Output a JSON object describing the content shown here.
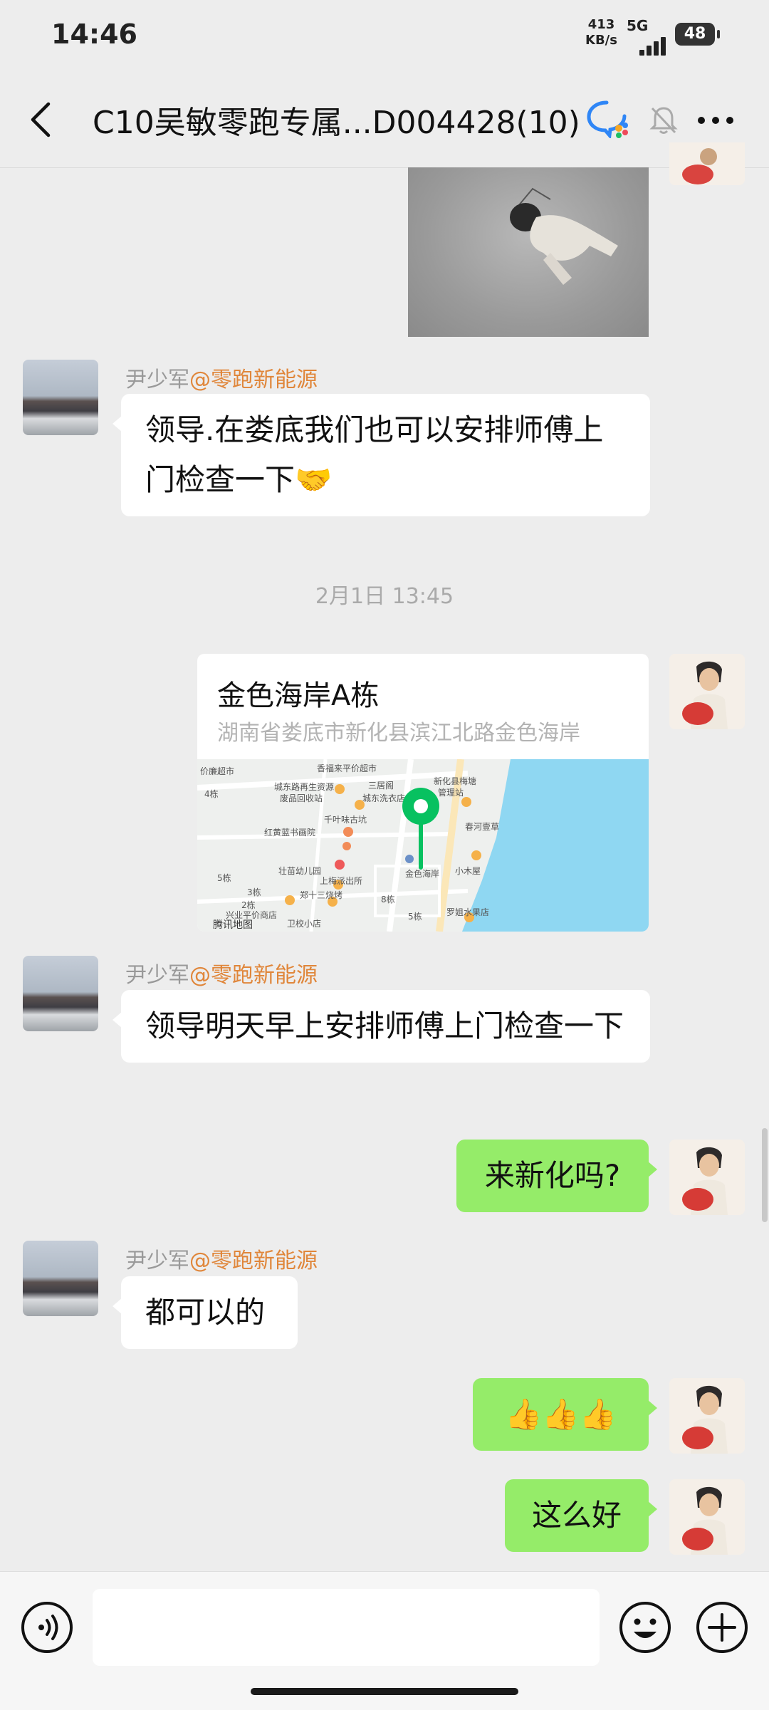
{
  "status_bar": {
    "time": "14:46",
    "net_speed_value": "413",
    "net_speed_unit": "KB/s",
    "network": "5G",
    "battery": "48"
  },
  "header": {
    "title": "C10吴敏零跑专属...D004428(10)",
    "icons": [
      "back-icon",
      "enterprise-chat-icon",
      "mute-bell-icon",
      "more-icon"
    ]
  },
  "messages": [
    {
      "type": "image",
      "side": "right",
      "content": "photo of a person lying on the ground"
    },
    {
      "type": "text",
      "side": "left",
      "sender": "尹少军",
      "sender_tag": "@零跑新能源",
      "text": "领导.在娄底我们也可以安排师傅上门检查一下🤝"
    },
    {
      "type": "timestamp",
      "text": "2月1日 13:45"
    },
    {
      "type": "location",
      "side": "right",
      "title": "金色海岸A栋",
      "address": "湖南省娄底市新化县滨江北路金色海岸",
      "map_labels": [
        "价廉超市",
        "香福来平价超市",
        "4栋",
        "城东路再生资源",
        "废品回收站",
        "三居阁",
        "城东洗衣店",
        "千叶味古坑",
        "新化县梅塘",
        "管理站",
        "春河壹草",
        "红黄蓝书画院",
        "壮苗幼儿园",
        "上梅派出所",
        "金色海岸",
        "小木屋",
        "郑十三烧烤",
        "5栋",
        "3栋",
        "2栋",
        "8栋",
        "兴业平价商店",
        "罗姐水果店",
        "卫校小店",
        "5栋",
        "腾讯地图"
      ]
    },
    {
      "type": "text",
      "side": "left",
      "sender": "尹少军",
      "sender_tag": "@零跑新能源",
      "text": "领导明天早上安排师傅上门检查一下"
    },
    {
      "type": "text",
      "side": "right",
      "text": "来新化吗?"
    },
    {
      "type": "text",
      "side": "left",
      "sender": "尹少军",
      "sender_tag": "@零跑新能源",
      "text": "都可以的"
    },
    {
      "type": "text",
      "side": "right",
      "text": "👍👍👍"
    },
    {
      "type": "text",
      "side": "right",
      "text": "这么好"
    }
  ],
  "input_bar": {
    "icons": [
      "voice-icon",
      "emoji-icon",
      "add-icon"
    ],
    "placeholder": ""
  },
  "colors": {
    "background": "#ededed",
    "sent_bubble": "#95ec69",
    "received_bubble": "#ffffff",
    "sender_tag": "#e0863a",
    "map_pin": "#07c160",
    "map_water": "#8fd7f2"
  }
}
